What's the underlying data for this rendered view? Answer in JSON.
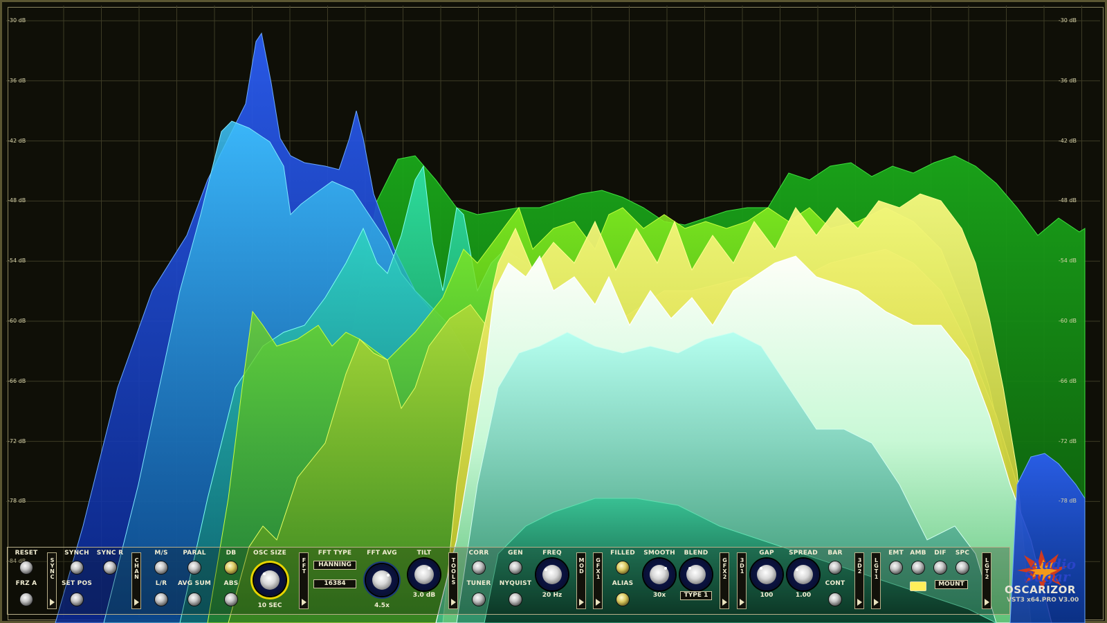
{
  "app": {
    "product_name": "OSCARIZOR",
    "version": "VST3 x64.PRO V3.00",
    "logo_text": "Audio Sugar"
  },
  "colors": {
    "background": "#0f0f07",
    "grid": "#3e3c26",
    "frame": "#8b8460",
    "knob_ring": "#e6d400",
    "led_yellow": "#ffef5a"
  },
  "db_scale": [
    "-30 dB",
    "-36 dB",
    "-42 dB",
    "-48 dB",
    "-54 dB",
    "-60 dB",
    "-66 dB",
    "-72 dB",
    "-78 dB",
    "-84 dB"
  ],
  "controls": {
    "reset": "RESET",
    "frz_a": "FRZ A",
    "sync_tab": "SYNC",
    "synch": "SYNCH",
    "sync_r": "SYNC R",
    "set_pos": "SET POS",
    "chan_tab": "CHAN",
    "ms": "M/S",
    "lr": "L/R",
    "paral": "PARAL",
    "avg_sum": "AVG SUM",
    "db": "DB",
    "abs": "ABS",
    "osc_size": "OSC SIZE",
    "osc_size_value": "10 SEC",
    "fft_tab": "FFT",
    "fft_type": "FFT TYPE",
    "fft_type_value": "HANNING",
    "fft_size_value": "16384",
    "fft_avg": "FFT AVG",
    "fft_avg_value": "4.5x",
    "tilt": "TILT",
    "tilt_value": "3.0 dB",
    "tools_tab": "TOOLS",
    "corr": "CORR",
    "tuner": "TUNER",
    "gen": "GEN",
    "nyquist": "NYQUIST",
    "freq": "FREQ",
    "freq_value": "20 Hz",
    "mod_tab": "MOD",
    "gfx1_tab": "GFX1",
    "filled": "FILLED",
    "alias": "ALIAS",
    "smooth": "SMOOTH",
    "smooth_value": "30x",
    "blend": "BLEND",
    "blend_value": "TYPE 1",
    "gfx2_tab": "GFX2",
    "3d1_tab": "3D1",
    "gap": "GAP",
    "gap_value": "100",
    "spread": "SPREAD",
    "spread_value": "1.00",
    "bar": "BAR",
    "cont": "CONT",
    "3d2_tab": "3D2",
    "lgt1_tab": "LGT1",
    "emt": "EMT",
    "amb": "AMB",
    "dif": "DIF",
    "spc": "SPC",
    "mount": "MOUNT",
    "lgt2_tab": "LGT2"
  }
}
